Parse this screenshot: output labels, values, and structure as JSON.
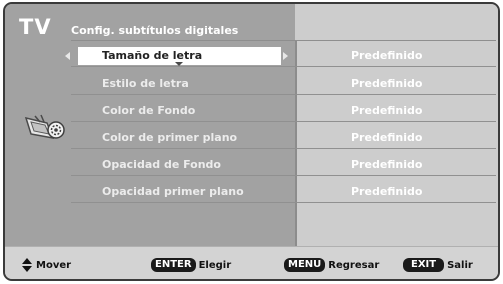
{
  "header": {
    "tv_label": "TV",
    "title": "Config. subtítulos digitales"
  },
  "menu": {
    "selected_index": 0,
    "items": [
      {
        "label": "Tamaño de letra",
        "value": "Predefinido"
      },
      {
        "label": "Estilo de letra",
        "value": "Predefinido"
      },
      {
        "label": "Color de Fondo",
        "value": "Predefinido"
      },
      {
        "label": "Color de primer plano",
        "value": "Predefinido"
      },
      {
        "label": "Opacidad de Fondo",
        "value": "Predefinido"
      },
      {
        "label": "Opacidad primer plano",
        "value": "Predefinido"
      }
    ]
  },
  "side_icon": "tv-setup-icon",
  "footer": {
    "move_icon": "up-down-arrows-icon",
    "move_label": "Mover",
    "enter_key": "ENTER",
    "enter_label": "Elegir",
    "menu_key": "MENU",
    "menu_label": "Regresar",
    "exit_key": "EXIT",
    "exit_label": "Salir"
  }
}
